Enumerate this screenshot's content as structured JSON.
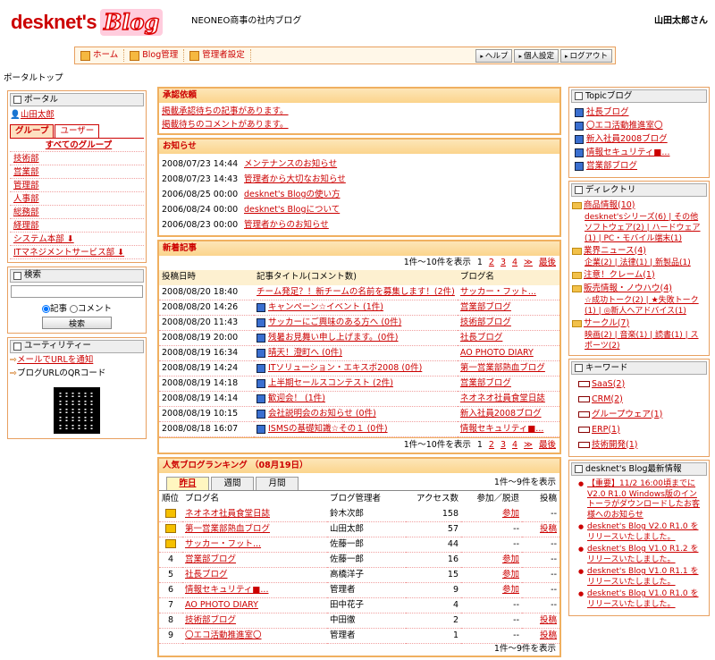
{
  "header": {
    "logo_main": "desknet's",
    "logo_blog": "Blog",
    "site_title": "NEONEO商事の社内ブログ",
    "user": "山田太郎さん"
  },
  "nav": {
    "items": [
      "ホーム",
      "Blog管理",
      "管理者設定"
    ],
    "right": [
      "ヘルプ",
      "個人設定",
      "ログアウト"
    ]
  },
  "breadcrumb": "ポータルトップ",
  "portal": {
    "title": "ポータル",
    "user": "山田太郎",
    "tabs": [
      "グループ",
      "ユーザー"
    ],
    "all_groups": "すべてのグループ",
    "groups": [
      "技術部",
      "営業部",
      "管理部",
      "人事部",
      "総務部",
      "経理部",
      "システム本部 ⬇",
      "ITマネジメントサービス部 ⬇"
    ]
  },
  "search": {
    "title": "検索",
    "radio_article": "記事",
    "radio_comment": "コメント",
    "button": "検索"
  },
  "utility": {
    "title": "ユーティリティー",
    "items": [
      "メールでURLを通知",
      "ブログURLのQRコード"
    ]
  },
  "approval": {
    "title": "承認依頼",
    "items": [
      "掲載承認待ちの記事があります。",
      "掲載待ちのコメントがあります。"
    ]
  },
  "notices": {
    "title": "お知らせ",
    "items": [
      {
        "date": "2008/07/23 14:44",
        "text": "メンテナンスのお知らせ"
      },
      {
        "date": "2008/07/23 14:43",
        "text": "管理者から大切なお知らせ"
      },
      {
        "date": "2006/08/25 00:00",
        "text": "desknet's Blogの使い方"
      },
      {
        "date": "2006/08/24 00:00",
        "text": "desknet's Blogについて"
      },
      {
        "date": "2006/08/23 00:00",
        "text": "管理者からのお知らせ"
      }
    ]
  },
  "recent": {
    "title": "新着記事",
    "range": "1件〜10件を表示",
    "pages": [
      "1",
      "2",
      "3",
      "4",
      "≫",
      "最後"
    ],
    "headers": [
      "投稿日時",
      "記事タイトル(コメント数)",
      "ブログ名"
    ],
    "rows": [
      {
        "date": "2008/08/20 18:40",
        "title": "チーム発足？！新チームの名前を募集します！(2件)",
        "blog": "サッカー・フット..."
      },
      {
        "date": "2008/08/20 14:26",
        "title": "キャンペーン☆イベント (1件)",
        "blog": "営業部ブログ"
      },
      {
        "date": "2008/08/20 11:43",
        "title": "サッカーにご興味のある方へ (0件)",
        "blog": "技術部ブログ"
      },
      {
        "date": "2008/08/19 20:00",
        "title": "残暑お見舞い申し上げます。(0件)",
        "blog": "社長ブログ"
      },
      {
        "date": "2008/08/19 16:34",
        "title": "晴天！澄町へ (0件)",
        "blog": "AO PHOTO DIARY"
      },
      {
        "date": "2008/08/19 14:24",
        "title": "ITソリューション・エキスポ2008 (0件)",
        "blog": "第一営業部熱血ブログ"
      },
      {
        "date": "2008/08/19 14:18",
        "title": "上半期セールスコンテスト (2件)",
        "blog": "営業部ブログ"
      },
      {
        "date": "2008/08/19 14:14",
        "title": "歓迎会！ (1件)",
        "blog": "ネオネオ社員食堂日誌"
      },
      {
        "date": "2008/08/19 10:15",
        "title": "会社説明会のお知らせ (0件)",
        "blog": "新入社員2008ブログ"
      },
      {
        "date": "2008/08/18 16:07",
        "title": "ISMSの基礎知識☆その１ (0件)",
        "blog": "情報セキュリティ■..."
      }
    ]
  },
  "ranking": {
    "title": "人気ブログランキング （08月19日）",
    "tabs": [
      "昨日",
      "週間",
      "月間"
    ],
    "range": "1件〜9件を表示",
    "headers": [
      "順位",
      "ブログ名",
      "ブログ管理者",
      "アクセス数",
      "参加／脱退",
      "投稿"
    ],
    "rows": [
      {
        "rank": "1",
        "name": "ネオネオ社員食堂日誌",
        "admin": "鈴木次郎",
        "access": "158",
        "join": "参加",
        "post": "--"
      },
      {
        "rank": "2",
        "name": "第一営業部熱血ブログ",
        "admin": "山田太郎",
        "access": "57",
        "join": "--",
        "post": "投稿"
      },
      {
        "rank": "3",
        "name": "サッカー・フット...",
        "admin": "佐藤一郎",
        "access": "44",
        "join": "--",
        "post": "--"
      },
      {
        "rank": "4",
        "name": "営業部ブログ",
        "admin": "佐藤一郎",
        "access": "16",
        "join": "参加",
        "post": "--"
      },
      {
        "rank": "5",
        "name": "社長ブログ",
        "admin": "高橋洋子",
        "access": "15",
        "join": "参加",
        "post": "--"
      },
      {
        "rank": "6",
        "name": "情報セキュリティ■...",
        "admin": "管理者",
        "access": "9",
        "join": "参加",
        "post": "--"
      },
      {
        "rank": "7",
        "name": "AO PHOTO DIARY",
        "admin": "田中花子",
        "access": "4",
        "join": "--",
        "post": "--"
      },
      {
        "rank": "8",
        "name": "技術部ブログ",
        "admin": "中田徹",
        "access": "2",
        "join": "--",
        "post": "投稿"
      },
      {
        "rank": "9",
        "name": "〇エコ活動推進室〇",
        "admin": "管理者",
        "access": "1",
        "join": "--",
        "post": "投稿"
      }
    ]
  },
  "topic": {
    "title": "Topicブログ",
    "items": [
      "社長ブログ",
      "〇エコ活動推進室〇",
      "新入社員2008ブログ",
      "情報セキュリティ■...",
      "営業部ブログ"
    ]
  },
  "directory": {
    "title": "ディレクトリ",
    "cats": [
      {
        "name": "商品情報(10)",
        "sub": "desknet'sシリーズ(6) | その他ソフトウェア(2) | ハードウェア(1) | PC・モバイル端末(1)"
      },
      {
        "name": "業界ニュース(4)",
        "sub": "企業(2) | 法律(1) | 新製品(1)"
      },
      {
        "name": "注意！クレーム(1)",
        "sub": ""
      },
      {
        "name": "販売情報・ノウハウ(4)",
        "sub": "☆成功トーク(2) | ★失敗トーク(1) | ◎新人へアドバイス(1)"
      },
      {
        "name": "サークル(7)",
        "sub": "映画(2) | 音楽(1) | 読書(1) | スポーツ(2)"
      }
    ]
  },
  "keyword": {
    "title": "キーワード",
    "items": [
      "SaaS(2)",
      "CRM(2)",
      "グループウェア(1)",
      "ERP(1)",
      "技術開発(1)"
    ]
  },
  "news": {
    "title": "desknet's Blog最新情報",
    "items": [
      "【重要】11/2 16:00頃までにV2.0 R1.0 Windows版のイントーラがダウンロードしたお客様へのお知らせ",
      "desknet's Blog V2.0 R1.0 をリリースいたしました。",
      "desknet's Blog V1.0 R1.2 をリリースいたしました。",
      "desknet's Blog V1.0 R1.1 をリリースいたしました。",
      "desknet's Blog V1.0 R1.0 をリリースいたしました。"
    ]
  }
}
